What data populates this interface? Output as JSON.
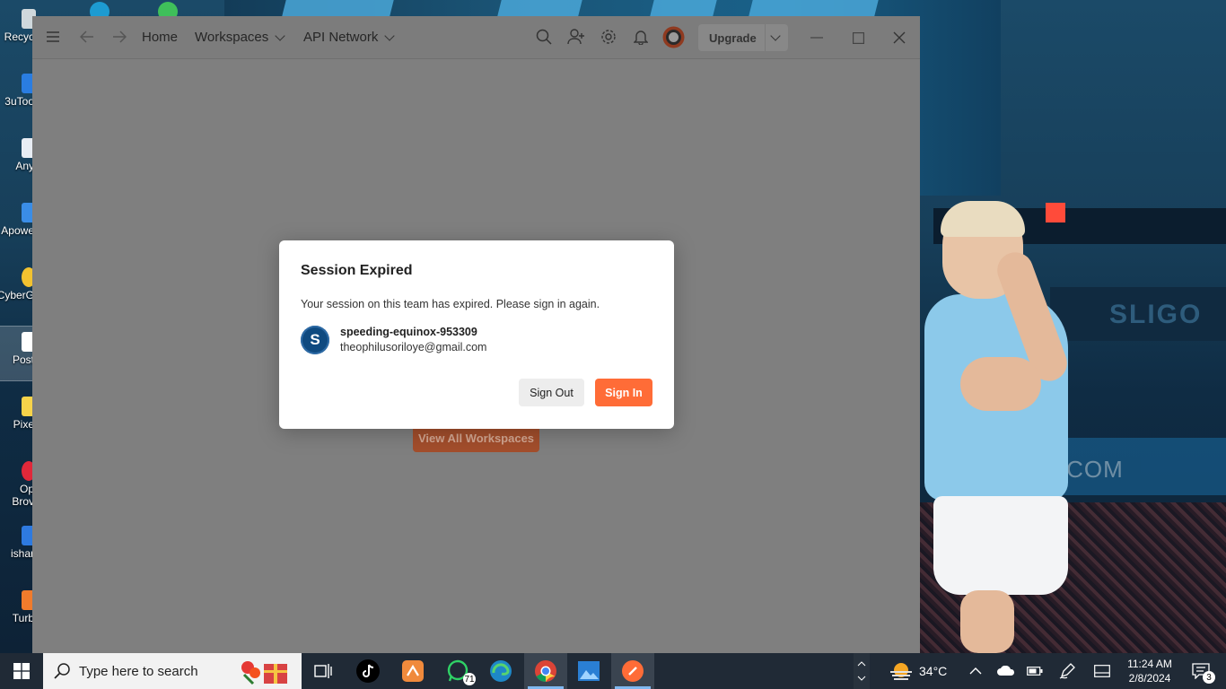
{
  "desktop": {
    "icons": [
      {
        "label": "Recyc",
        "label2": "",
        "icon": "recycle-bin-icon"
      },
      {
        "label": "3uToo",
        "label2": "",
        "icon": "3utools-icon"
      },
      {
        "label": "Any",
        "label2": "",
        "icon": "anydesk-icon"
      },
      {
        "label": "Apowe",
        "label2": "",
        "icon": "apowersoft-icon"
      },
      {
        "label": "CyberG",
        "label2": "",
        "icon": "cyberghost-icon"
      },
      {
        "label": "Post",
        "label2": "",
        "icon": "postman-icon"
      },
      {
        "label": "Pixe",
        "label2": "",
        "icon": "pixel-icon"
      },
      {
        "label": "Op",
        "label2": "Brov",
        "icon": "opera-browser-icon"
      },
      {
        "label": "ishar",
        "label2": "",
        "icon": "shareit-icon"
      },
      {
        "label": "Turb",
        "label2": "",
        "icon": "turbo-icon"
      }
    ],
    "wallpaper_texts": {
      "ad_sligo": "SLIGO",
      "ad_direct": "DIRECT.COM"
    }
  },
  "app": {
    "nav": {
      "home": "Home",
      "workspaces": "Workspaces",
      "api_network": "API Network"
    },
    "upgrade_label": "Upgrade",
    "background_button": "View All Workspaces",
    "colors": {
      "accent": "#ff6c37",
      "dim_overlay": "#7f7f7f"
    }
  },
  "modal": {
    "title": "Session Expired",
    "message": "Your session on this team has expired. Please sign in again.",
    "avatar_letter": "S",
    "team_name": "speeding-equinox-953309",
    "email": "theophilusoriloye@gmail.com",
    "sign_out": "Sign Out",
    "sign_in": "Sign In"
  },
  "taskbar": {
    "search_placeholder": "Type here to search",
    "apps": [
      {
        "name": "task-view-icon"
      },
      {
        "name": "tiktok-icon"
      },
      {
        "name": "app-orange-icon"
      },
      {
        "name": "whatsapp-icon",
        "badge": "71"
      },
      {
        "name": "edge-icon"
      },
      {
        "name": "chrome-icon"
      },
      {
        "name": "photos-icon"
      },
      {
        "name": "postman-icon"
      }
    ],
    "weather": "34°C",
    "time": "11:24 AM",
    "date": "2/8/2024",
    "notification_count": "3"
  }
}
